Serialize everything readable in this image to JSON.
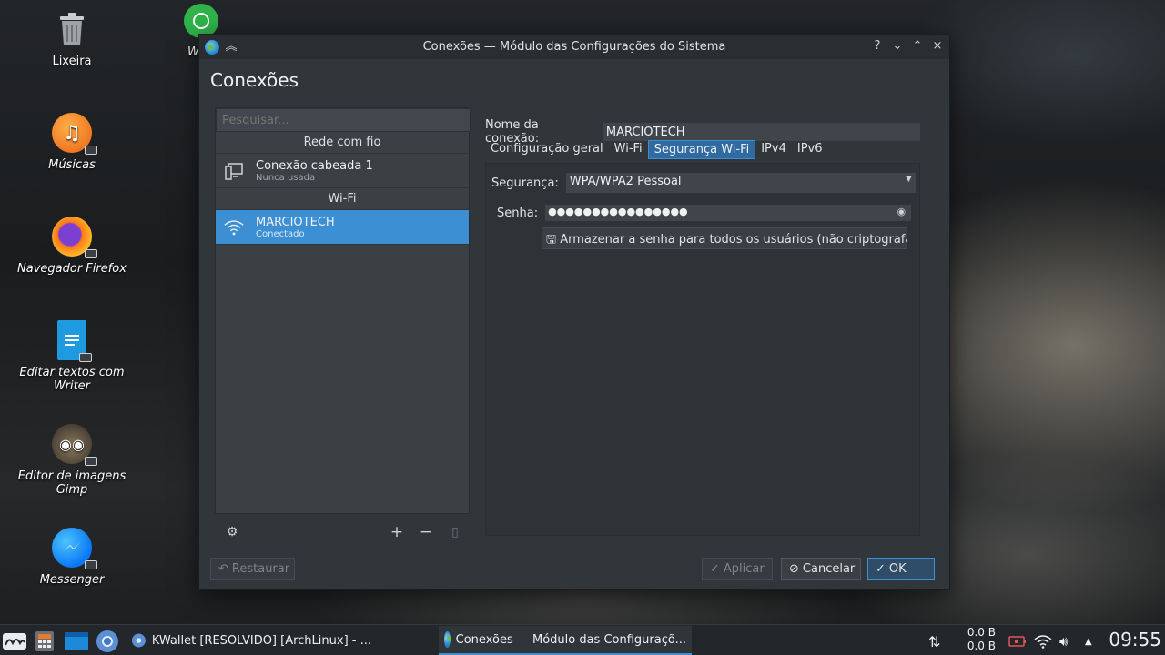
{
  "desktop": {
    "icons": [
      {
        "label": "Lixeira",
        "icon": "trash-icon",
        "italic": false
      },
      {
        "label": "Músicas",
        "icon": "music-icon",
        "italic": true
      },
      {
        "label": "Navegador Firefox",
        "icon": "firefox-icon",
        "italic": true
      },
      {
        "label": "Editar textos com Writer",
        "icon": "writer-icon",
        "italic": true
      },
      {
        "label": "Editor de imagens Gimp",
        "icon": "gimp-icon",
        "italic": true
      },
      {
        "label": "Messenger",
        "icon": "messenger-icon",
        "italic": true
      }
    ],
    "partial_icon_label": "W"
  },
  "window": {
    "title": "Conexões — Módulo das Configurações do Sistema",
    "titlebar_buttons": [
      "?",
      "⌄",
      "⌃",
      "×"
    ],
    "page_title": "Conexões",
    "search_placeholder": "Pesquisar...",
    "sections": [
      {
        "header": "Rede com fio",
        "items": [
          {
            "name": "Conexão cabeada 1",
            "status": "Nunca usada",
            "icon": "wired-network-icon",
            "selected": false
          }
        ]
      },
      {
        "header": "Wi-Fi",
        "items": [
          {
            "name": "MARCIOTECH",
            "status": "Conectado",
            "icon": "wifi-icon",
            "selected": true
          }
        ]
      }
    ],
    "left_toolbar": {
      "config": "settings-sliders-icon",
      "add": "+",
      "remove": "−",
      "export": "export-icon"
    },
    "connection_name_label": "Nome da conexão:",
    "connection_name_value": "MARCIOTECH",
    "tabs": [
      "Configuração geral",
      "Wi-Fi",
      "Segurança Wi-Fi",
      "IPv4",
      "IPv6"
    ],
    "active_tab": "Segurança Wi-Fi",
    "security_label": "Segurança:",
    "security_value": "WPA/WPA2 Pessoal",
    "password_label": "Senha:",
    "password_mask": "●●●●●●●●●●●●●●●●",
    "store_password_label": "Armazenar a senha para todos os usuários (não criptografada)",
    "buttons": {
      "restore": "Restaurar",
      "apply": "Aplicar",
      "cancel": "Cancelar",
      "ok": "OK"
    }
  },
  "taskbar": {
    "tasks": [
      {
        "label": "KWallet [RESOLVIDO] [ArchLinux] - ...",
        "active": false
      },
      {
        "label": "Conexões — Módulo das Configuraçõ...",
        "active": true
      }
    ],
    "net_up": "0.0 B",
    "net_down": "0.0 B",
    "clock": "09:55"
  }
}
